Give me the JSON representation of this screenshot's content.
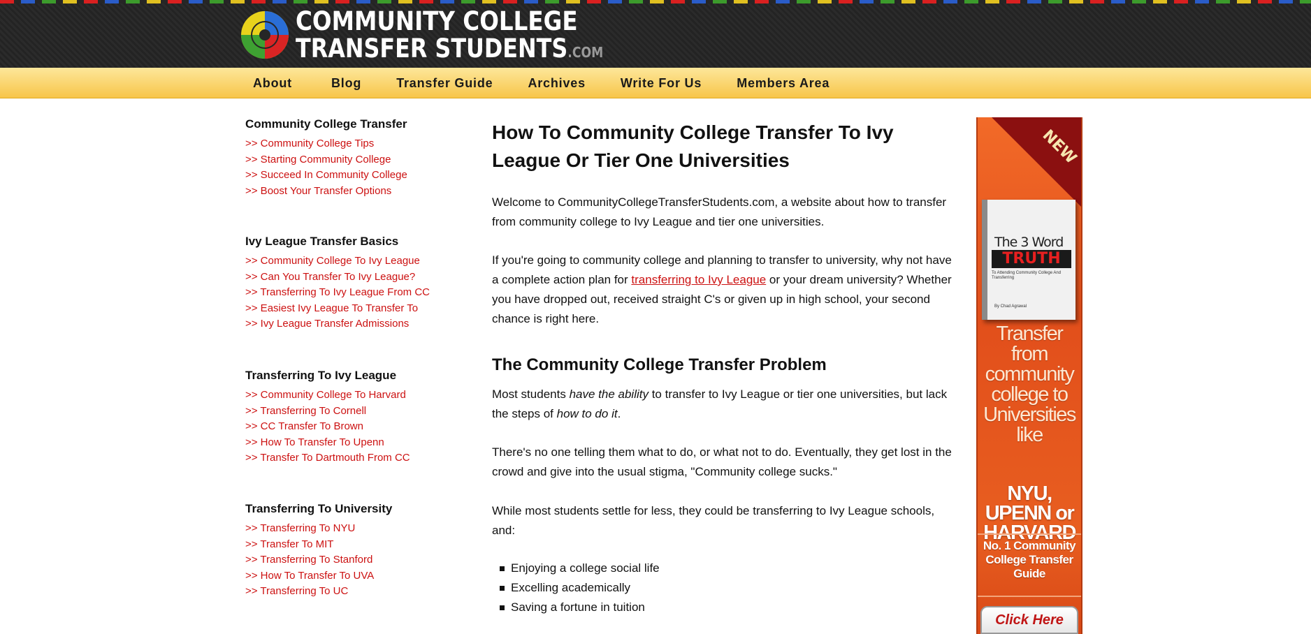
{
  "site": {
    "logo_line1": "COMMUNITY COLLEGE",
    "logo_line2": "TRANSFER STUDENTS",
    "logo_dotcom": ".COM"
  },
  "nav": {
    "items": [
      {
        "label": "About"
      },
      {
        "label": "Blog"
      },
      {
        "label": "Transfer Guide"
      },
      {
        "label": "Archives"
      },
      {
        "label": "Write For Us"
      },
      {
        "label": "Members Area"
      }
    ]
  },
  "sidebar": {
    "sections": [
      {
        "heading": "Community College Transfer",
        "links": [
          ">> Community College Tips",
          ">> Starting Community College",
          ">> Succeed In Community College",
          ">> Boost Your Transfer Options"
        ]
      },
      {
        "heading": "Ivy League Transfer Basics",
        "links": [
          ">> Community College To Ivy League",
          ">> Can You Transfer To Ivy League?",
          ">> Transferring To Ivy League From CC",
          ">> Easiest Ivy League To Transfer To",
          ">> Ivy League Transfer Admissions"
        ]
      },
      {
        "heading": "Transferring To Ivy League",
        "links": [
          ">> Community College To Harvard",
          ">> Transferring To Cornell",
          ">> CC Transfer To Brown",
          ">> How To Transfer To Upenn",
          ">> Transfer To Dartmouth From CC"
        ]
      },
      {
        "heading": "Transferring To University",
        "links": [
          ">> Transferring To NYU",
          ">> Transfer To MIT",
          ">> Transferring To Stanford",
          ">> How To Transfer To UVA",
          ">> Transferring To UC"
        ]
      }
    ]
  },
  "main": {
    "title": "How To Community College Transfer To Ivy League Or Tier One Universities",
    "intro": "Welcome to CommunityCollegeTransferStudents.com, a website about how to transfer from community college to Ivy League and tier one universities.",
    "p2_before": "If you're going to community college and planning to transfer to university, why not have a complete action plan for ",
    "p2_link": "transferring to Ivy League",
    "p2_after": " or your dream university? Whether you have dropped out, received straight C's or given up in high school, your second chance is right here.",
    "section_heading": "The Community College Transfer Problem",
    "p3_a": "Most students ",
    "p3_em1": "have the ability",
    "p3_b": " to transfer to Ivy League or tier one universities, but lack the steps of ",
    "p3_em2": "how to do it",
    "p3_c": ".",
    "p4": "There's no one telling them what to do, or what not to do. Eventually, they get lost in the crowd and give into the usual stigma, \"Community college sucks.\"",
    "p5": "While most students settle for less, they could be transferring to Ivy League schools, and:",
    "bullets": [
      "Enjoying a college social life",
      "Excelling academically",
      "Saving a fortune in tuition"
    ]
  },
  "ad": {
    "badge": "NEW",
    "book_the": "The 3 Word",
    "book_truth": "TRUTH",
    "book_sub": "To Attending Community College And Transferring",
    "book_author": "By Chad Agrawal",
    "tagline": "Transfer from community college to Universities like",
    "names": "NYU, UPENN or HARVARD",
    "guide": "No. 1 Community College Transfer Guide",
    "button": "Click Here"
  }
}
